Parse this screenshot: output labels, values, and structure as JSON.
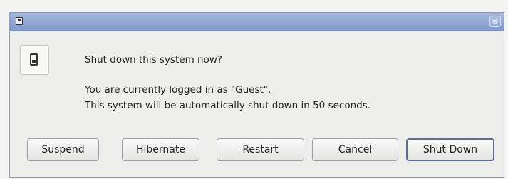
{
  "dialog": {
    "question": "Shut down this system now?",
    "info_line1": "You are currently logged in as \"Guest\".",
    "info_line2": "This system will be automatically shut down in 50 seconds.",
    "icon": "power-switch-icon"
  },
  "titlebar": {
    "window_icon": "window-menu-icon",
    "close_glyph": "⊗"
  },
  "buttons": {
    "suspend": "Suspend",
    "hibernate": "Hibernate",
    "restart": "Restart",
    "cancel": "Cancel",
    "shutdown": "Shut Down"
  },
  "colors": {
    "titlebar": "#8ea4d2",
    "background": "#ededeb"
  }
}
